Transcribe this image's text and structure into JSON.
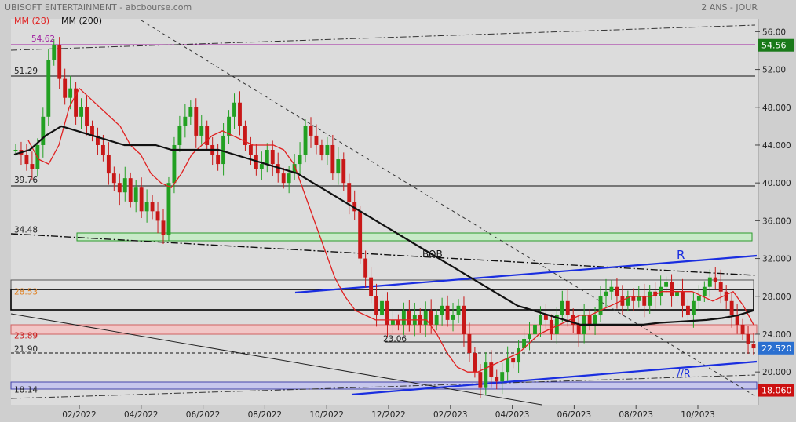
{
  "header": {
    "title": "UBISOFT ENTERTAINMENT - abcbourse.com",
    "period": "2 ANS - JOUR"
  },
  "legend": [
    {
      "label": "MM (28)",
      "color": "#e02020"
    },
    {
      "label": "MM (200)",
      "color": "#111111"
    }
  ],
  "chart_data": {
    "type": "candlestick",
    "y_ticks": [
      "56.00",
      "52.00",
      "48.000",
      "44.000",
      "40.000",
      "36.000",
      "32.000",
      "28.000",
      "24.000",
      "20.000"
    ],
    "y_tick_values": [
      56,
      52,
      48,
      44,
      40,
      36,
      32,
      28,
      24,
      20
    ],
    "x_ticks": [
      "02/2022",
      "04/2022",
      "06/2022",
      "08/2022",
      "10/2022",
      "12/2022",
      "02/2023",
      "04/2023",
      "06/2023",
      "08/2023",
      "10/2023"
    ],
    "ylim": [
      16.5,
      57.5
    ],
    "level_labels": [
      {
        "text": "54.62",
        "value": 54.62,
        "color": "#a020a0"
      },
      {
        "text": "51.29",
        "value": 51.29,
        "color": "#222222"
      },
      {
        "text": "39.76",
        "value": 39.76,
        "color": "#222222"
      },
      {
        "text": "34.48",
        "value": 34.48,
        "color": "#222222"
      },
      {
        "text": "28.53",
        "value": 28.53,
        "color": "#e08020"
      },
      {
        "text": "23.89",
        "value": 23.89,
        "color": "#cc2020"
      },
      {
        "text": "21.90",
        "value": 21.9,
        "color": "#222222"
      },
      {
        "text": "18.14",
        "value": 18.14,
        "color": "#222222"
      },
      {
        "text": "23.06",
        "value": 23.06,
        "color": "#222222"
      }
    ],
    "price_badges": [
      {
        "text": "54.56",
        "value": 54.56,
        "bg": "#1a7a1a"
      },
      {
        "text": "22.520",
        "value": 22.52,
        "bg": "#2a6fd0"
      },
      {
        "text": "18.060",
        "value": 18.06,
        "bg": "#cc1111"
      }
    ],
    "annotations": [
      "BOB",
      "R",
      "//R"
    ],
    "close_series": [
      43.5,
      43,
      42,
      41.5,
      44,
      47,
      53,
      54.6,
      51,
      49,
      50,
      47,
      48,
      46,
      45,
      44,
      43,
      41,
      40,
      39,
      40.5,
      38,
      39.5,
      37,
      38,
      37,
      36,
      34.5,
      40,
      44,
      46,
      47,
      48,
      45,
      46,
      44,
      43,
      42,
      45,
      47,
      48.5,
      46,
      44,
      43,
      41.5,
      42,
      43.5,
      42,
      41,
      40,
      41,
      42,
      43,
      46,
      45,
      44,
      43,
      44,
      41,
      42.5,
      40,
      38,
      37,
      32,
      30,
      28,
      26,
      27.5,
      25,
      25.5,
      25,
      26.5,
      25,
      26,
      25,
      26.5,
      25,
      26,
      27,
      25.5,
      26,
      27,
      24,
      22,
      20,
      18.3,
      21,
      19.5,
      19,
      20,
      21.5,
      21,
      22.5,
      23.5,
      24,
      25,
      26,
      25.5,
      24,
      26,
      27.5,
      26,
      25,
      24,
      26,
      25,
      26,
      28,
      28.5,
      29,
      28,
      27,
      28,
      27.5,
      28,
      27,
      28.5,
      28,
      29,
      29.5,
      28,
      28.5,
      27,
      26,
      27.5,
      28,
      29,
      30,
      29.5,
      28.5,
      27.5,
      26,
      25,
      24,
      23,
      22.5
    ],
    "ma28": [
      44.5,
      42.5,
      42,
      44,
      48,
      50,
      49,
      48,
      47,
      46,
      44,
      43,
      41,
      40,
      39.5,
      41,
      43,
      44,
      45,
      45.5,
      45,
      44.5,
      44,
      44,
      44,
      43.5,
      42,
      39,
      36,
      33,
      30,
      28,
      26.5,
      26,
      25.5,
      25.5,
      25.5,
      25.5,
      25.5,
      25.5,
      24,
      22,
      20.5,
      20,
      20,
      20.5,
      21,
      21.5,
      22,
      23,
      24,
      24.5,
      25,
      25.5,
      26,
      26,
      26.5,
      27,
      27.5,
      28,
      28,
      28,
      28.5,
      28.5,
      28.5,
      28.5,
      28,
      27.5,
      28,
      28.5,
      27,
      25
    ],
    "ma200": [
      43,
      43.5,
      45,
      46,
      45.5,
      45,
      44.5,
      44,
      44,
      44,
      43.5,
      43.5,
      43.5,
      43.5,
      43,
      42.5,
      42,
      41.5,
      41,
      40,
      39,
      38,
      37,
      36,
      35,
      34,
      33,
      32,
      31,
      30,
      29,
      28,
      27,
      26.5,
      26,
      25.5,
      25,
      25,
      25,
      25,
      25,
      25.2,
      25.3,
      25.4,
      25.5,
      25.7,
      26,
      26.5
    ],
    "series": [
      {
        "name": "MM (28)",
        "role": "ma28"
      },
      {
        "name": "MM (200)",
        "role": "ma200"
      }
    ]
  }
}
